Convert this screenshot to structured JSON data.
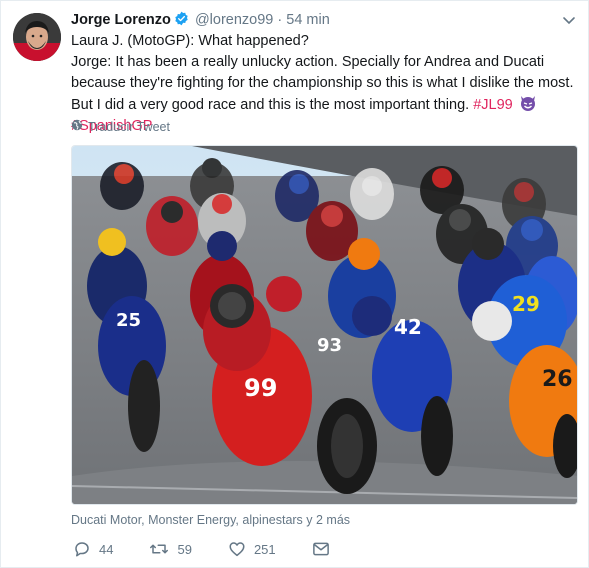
{
  "tweet": {
    "display_name": "Jorge Lorenzo",
    "handle": "@lorenzo99",
    "separator": "·",
    "time": "54 min",
    "line1": "Laura J. (MotoGP): What happened?",
    "line2_text": "Jorge: It has been a really unlucky action. Specially for Andrea and Ducati because they're fighting for the championship so this is what I dislike the most. But I did a very good race and this is the most important thing.",
    "hashtag1": "#JL99",
    "hashtag2": "#SpanishGP",
    "emoji": "smiling-devil-emoji",
    "translate_label": "Traducir Tweet",
    "tagged": "Ducati Motor, Monster Energy, alpinestars y 2 más",
    "bike_numbers": [
      "25",
      "29",
      "42",
      "26",
      "99",
      "93"
    ]
  },
  "actions": {
    "reply_count": "44",
    "retweet_count": "59",
    "like_count": "251"
  },
  "icons": {
    "verified": "verified-badge-icon",
    "caret": "chevron-down-icon",
    "globe": "globe-icon",
    "reply": "reply-icon",
    "retweet": "retweet-icon",
    "like": "heart-icon",
    "dm": "envelope-icon"
  },
  "colors": {
    "link": "#e0245e",
    "verified": "#1da1f2",
    "muted": "#657786",
    "text": "#14171a"
  }
}
